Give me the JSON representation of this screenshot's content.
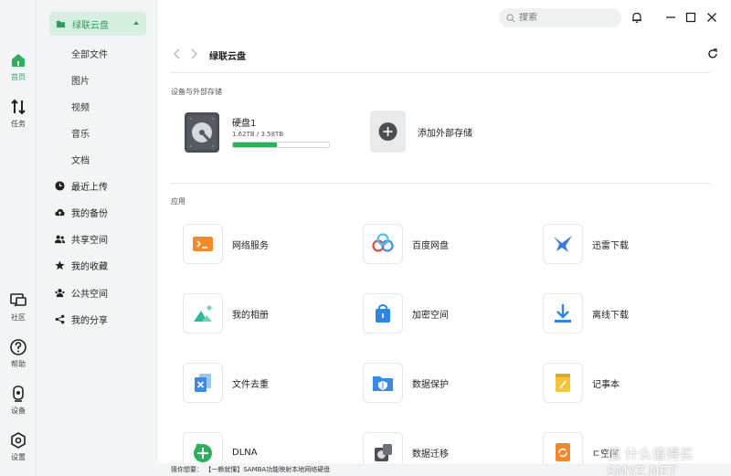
{
  "rail": {
    "items": [
      {
        "label": "首页",
        "icon": "home-icon"
      },
      {
        "label": "任务",
        "icon": "transfer-icon"
      },
      {
        "label": "社区",
        "icon": "chat-icon"
      },
      {
        "label": "帮助",
        "icon": "help-icon"
      },
      {
        "label": "设备",
        "icon": "device-icon"
      },
      {
        "label": "设置",
        "icon": "settings-icon"
      }
    ]
  },
  "sidebar": {
    "head": "绿联云盘",
    "subitems": [
      "全部文件",
      "图片",
      "视频",
      "音乐",
      "文档"
    ],
    "items": [
      {
        "label": "最近上传",
        "icon": "clock-icon"
      },
      {
        "label": "我的备份",
        "icon": "cloud-upload-icon"
      },
      {
        "label": "共享空间",
        "icon": "users-icon"
      },
      {
        "label": "我的收藏",
        "icon": "star-icon"
      },
      {
        "label": "公共空间",
        "icon": "group-icon"
      },
      {
        "label": "我的分享",
        "icon": "share-icon"
      }
    ]
  },
  "search": {
    "placeholder": "搜索"
  },
  "header": {
    "breadcrumb": "绿联云盘"
  },
  "storage": {
    "title": "设备与外部存储",
    "disk_name": "硬盘1",
    "disk_usage": "1.62TB / 3.58TB",
    "used_fraction": 0.4525,
    "add_label": "添加外部存储"
  },
  "apps": {
    "title": "应用",
    "items": [
      {
        "label": "网络服务",
        "icon": "terminal-icon"
      },
      {
        "label": "百度网盘",
        "icon": "baidu-icon"
      },
      {
        "label": "迅雷下载",
        "icon": "thunder-bird-icon"
      },
      {
        "label": "我的相册",
        "icon": "photo-icon"
      },
      {
        "label": "加密空间",
        "icon": "lock-bag-icon"
      },
      {
        "label": "离线下载",
        "icon": "download-icon"
      },
      {
        "label": "文件去重",
        "icon": "dedupe-icon"
      },
      {
        "label": "数据保护",
        "icon": "shield-folder-icon"
      },
      {
        "label": "记事本",
        "icon": "notepad-icon"
      },
      {
        "label": "DLNA",
        "icon": "dlna-icon"
      },
      {
        "label": "数据迁移",
        "icon": "migrate-icon"
      },
      {
        "label": "ㄷ空间",
        "icon": "sync-doc-icon"
      }
    ]
  },
  "bottom": {
    "text": "猜你想要：  【一赖就懂】SAMBA功能映射本地网络硬盘"
  },
  "watermark": "值 什么值得买 SMYZ.NET",
  "colors": {
    "accent": "#2fae5b",
    "sidebar_bg": "#f3f4f6",
    "highlight_bg": "#d7efe0"
  }
}
